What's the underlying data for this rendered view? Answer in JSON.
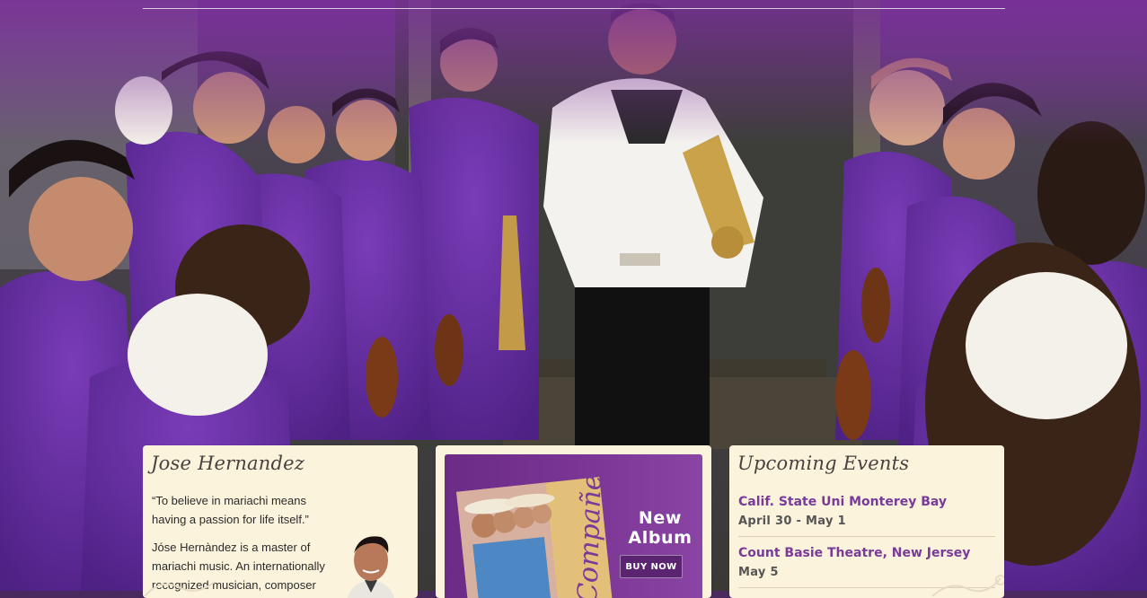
{
  "bio": {
    "title": "Jose Hernandez",
    "quote": "“To believe in mariachi means having a passion for life itself.”",
    "text": "Jóse Hernàndez is a master of mariachi music. An internationally recognized musician, composer"
  },
  "album": {
    "cover_title": "Compañeras",
    "label": "New Album",
    "button": "BUY NOW"
  },
  "events": {
    "title": "Upcoming Events",
    "items": [
      {
        "name": "Calif. State Uni Monterey Bay",
        "date": "April 30 - May 1"
      },
      {
        "name": "Count Basie Theatre, New Jersey",
        "date": "May 5"
      }
    ]
  },
  "colors": {
    "accent": "#7a3a98",
    "card_bg": "#fcf3dc",
    "uniform_purple": "#6b2fa0"
  }
}
